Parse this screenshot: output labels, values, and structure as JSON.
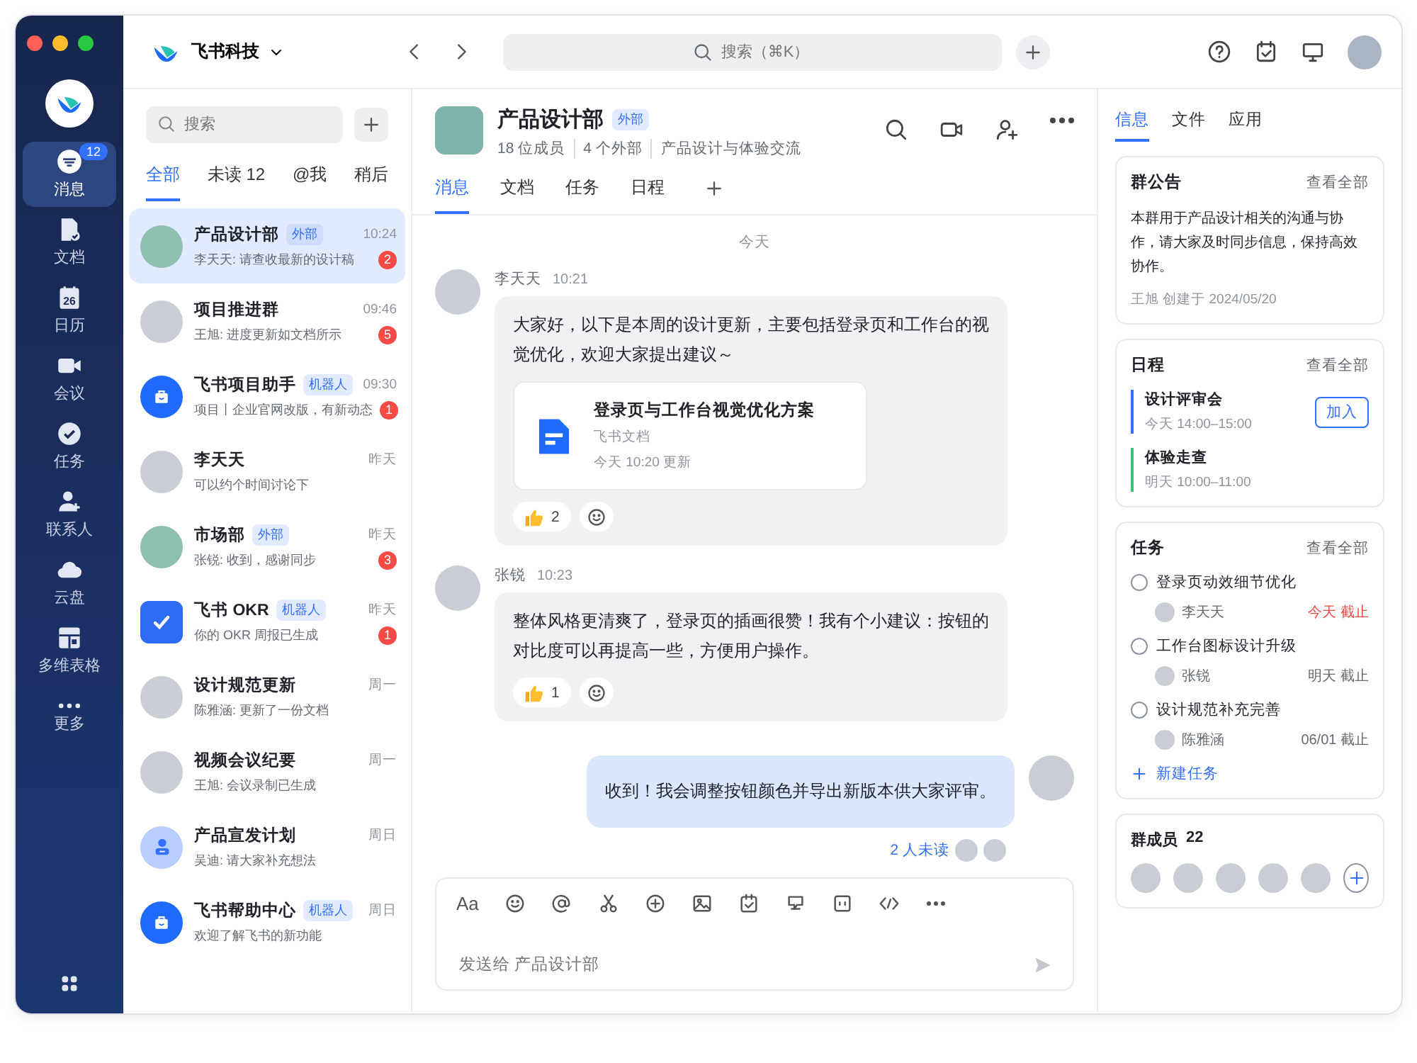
{
  "nav": {
    "items": [
      {
        "kind": "message",
        "label": "消息",
        "badge": "12",
        "selected": true
      },
      {
        "kind": "doc",
        "label": "文档",
        "selected": false
      },
      {
        "kind": "calendar",
        "icon_text": "26",
        "label": "日历",
        "selected": false
      },
      {
        "kind": "video",
        "label": "会议",
        "selected": false
      },
      {
        "kind": "task",
        "label": "任务",
        "selected": false
      },
      {
        "kind": "contact",
        "label": "联系人",
        "selected": false
      },
      {
        "kind": "cloud",
        "label": "云盘",
        "selected": false
      },
      {
        "kind": "table",
        "label": "多维表格",
        "selected": false
      },
      {
        "kind": "more",
        "label": "更多",
        "selected": false
      }
    ]
  },
  "topbar": {
    "org": "飞书科技",
    "search": {
      "placeholder": "搜索（⌘K）"
    }
  },
  "chat_list": {
    "search": {
      "placeholder": "搜索"
    },
    "tabs": [
      {
        "label": "全部",
        "selected": true
      },
      {
        "label": "未读 12",
        "selected": false
      },
      {
        "label": "@我",
        "selected": false
      },
      {
        "label": "稍后",
        "selected": false
      }
    ],
    "items": [
      {
        "kind": "group",
        "name": "产品设计部",
        "tag": "外部",
        "time": "10:24",
        "preview": "李天天: 请查收最新的设计稿",
        "unread": "2",
        "selected": true
      },
      {
        "kind": "photo",
        "name": "项目推进群",
        "time": "09:46",
        "preview": "王旭: 进度更新如文档所示",
        "unread": "5",
        "selected": false
      },
      {
        "kind": "bot",
        "name": "飞书项目助手",
        "tag": "机器人",
        "time": "09:30",
        "preview": "项目丨企业官网改版，有新动态",
        "unread": "1",
        "selected": false
      },
      {
        "kind": "photo",
        "name": "李天天",
        "time": "昨天",
        "preview": "可以约个时间讨论下",
        "selected": false
      },
      {
        "kind": "group",
        "name": "市场部",
        "tag": "外部",
        "time": "昨天",
        "preview": "张锐: 收到，感谢同步",
        "unread": "3",
        "selected": false
      },
      {
        "kind": "check",
        "name": "飞书 OKR",
        "tag": "机器人",
        "time": "昨天",
        "preview": "你的 OKR 周报已生成",
        "unread": "1",
        "selected": false
      },
      {
        "kind": "photo",
        "name": "设计规范更新",
        "time": "周一",
        "preview": "陈雅涵: 更新了一份文档",
        "selected": false
      },
      {
        "kind": "photo",
        "name": "视频会议纪要",
        "time": "周一",
        "preview": "王旭: 会议录制已生成",
        "selected": false
      },
      {
        "kind": "user",
        "name": "产品宣发计划",
        "time": "周日",
        "preview": "吴迪: 请大家补充想法",
        "selected": false
      },
      {
        "kind": "bot",
        "name": "飞书帮助中心",
        "tag": "机器人",
        "time": "周日",
        "preview": "欢迎了解飞书的新功能",
        "selected": false
      }
    ]
  },
  "chat": {
    "title": "产品设计部",
    "tag": "外部",
    "meta": [
      "18 位成员",
      "4 个外部",
      "产品设计与体验交流"
    ],
    "tabs": [
      {
        "label": "消息",
        "selected": true
      },
      {
        "label": "文档",
        "selected": false
      },
      {
        "label": "任务",
        "selected": false
      },
      {
        "label": "日程",
        "selected": false
      }
    ],
    "date_divider": "今天",
    "messages": [
      {
        "kind": "incoming",
        "sender": "李天天",
        "time": "10:21",
        "text": "大家好，以下是本周的设计更新，主要包括登录页和工作台的视觉优化，欢迎大家提出建议～",
        "attachment": {
          "title": "登录页与工作台视觉优化方案",
          "source": "飞书文档",
          "updated": "今天 10:20 更新"
        },
        "reactions": [
          {
            "count": "2"
          }
        ]
      },
      {
        "kind": "incoming",
        "sender": "张锐",
        "time": "10:23",
        "text": "整体风格更清爽了，登录页的插画很赞！我有个小建议：按钮的对比度可以再提高一些，方便用户操作。",
        "reactions": [
          {
            "count": "1"
          }
        ]
      },
      {
        "kind": "outgoing",
        "text": "收到！我会调整按钮颜色并导出新版本供大家评审。",
        "read_status": "2 人未读"
      }
    ],
    "composer": {
      "format_label": "Aa",
      "placeholder": "发送给 产品设计部"
    }
  },
  "side": {
    "tabs": [
      {
        "label": "信息",
        "selected": true
      },
      {
        "label": "文件",
        "selected": false
      },
      {
        "label": "应用",
        "selected": false
      }
    ],
    "announcement": {
      "title": "群公告",
      "link": "查看全部",
      "text": "本群用于产品设计相关的沟通与协作，请大家及时同步信息，保持高效协作。",
      "footer": "王旭 创建于 2024/05/20"
    },
    "schedule": {
      "title": "日程",
      "link": "查看全部",
      "events": [
        {
          "title": "设计评审会",
          "time": "今天 14:00–15:00",
          "color": "#3370ff",
          "action": "加入"
        },
        {
          "title": "体验走查",
          "time": "明天 10:00–11:00",
          "color": "#34c77b"
        }
      ]
    },
    "tasks": {
      "title": "任务",
      "link": "查看全部",
      "items": [
        {
          "title": "登录页动效细节优化",
          "assignee": "李天天",
          "due": "今天 截止",
          "urgent": true,
          "checked": false
        },
        {
          "title": "工作台图标设计升级",
          "assignee": "张锐",
          "due": "明天 截止",
          "urgent": false,
          "checked": false
        },
        {
          "title": "设计规范补充完善",
          "assignee": "陈雅涵",
          "due": "06/01 截止",
          "urgent": false,
          "checked": false
        }
      ],
      "new_task": "新建任务"
    },
    "members": {
      "title": "群成员",
      "count": "22"
    }
  }
}
